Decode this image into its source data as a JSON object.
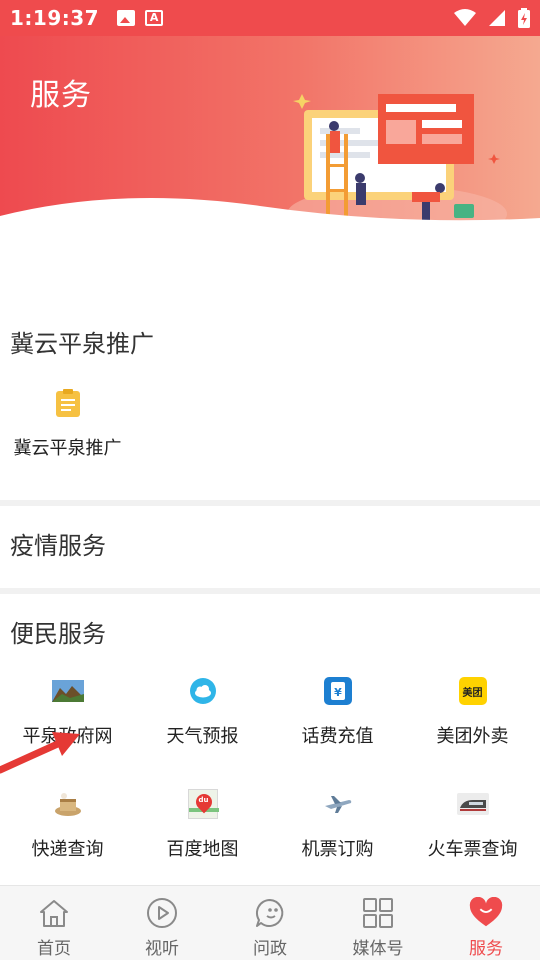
{
  "status_bar": {
    "time": "1:19:37",
    "font_icon_letter": "A"
  },
  "header": {
    "title": "服务"
  },
  "sections": {
    "promo": {
      "title": "冀云平泉推广",
      "items": [
        {
          "label": "冀云平泉推广",
          "icon": "document-icon"
        }
      ]
    },
    "epidemic": {
      "title": "疫情服务"
    },
    "convenience": {
      "title": "便民服务",
      "items": [
        {
          "label": "平泉政府网",
          "icon": "landscape-icon"
        },
        {
          "label": "天气预报",
          "icon": "weather-icon"
        },
        {
          "label": "话费充值",
          "icon": "phone-recharge-icon"
        },
        {
          "label": "美团外卖",
          "icon": "meituan-icon",
          "icon_text": "美团"
        },
        {
          "label": "快递查询",
          "icon": "parcel-icon"
        },
        {
          "label": "百度地图",
          "icon": "map-icon",
          "icon_text": "du"
        },
        {
          "label": "机票订购",
          "icon": "airplane-icon"
        },
        {
          "label": "火车票查询",
          "icon": "train-icon"
        }
      ]
    }
  },
  "bottom_nav": {
    "items": [
      {
        "label": "首页",
        "icon": "home-icon"
      },
      {
        "label": "视听",
        "icon": "play-icon"
      },
      {
        "label": "问政",
        "icon": "chat-icon"
      },
      {
        "label": "媒体号",
        "icon": "grid-icon"
      },
      {
        "label": "服务",
        "icon": "heart-icon",
        "active": true
      }
    ]
  },
  "colors": {
    "accent": "#ef4b4d",
    "header_gradient_start": "#ee4a4f",
    "header_gradient_end": "#f5a990",
    "divider": "#f1f1f1"
  }
}
